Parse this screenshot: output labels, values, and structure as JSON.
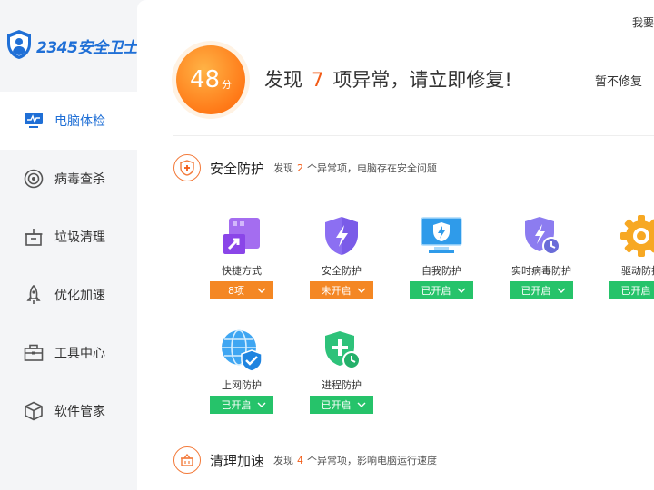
{
  "app": {
    "logo_text": "2345安全卫士"
  },
  "sidebar": {
    "items": [
      {
        "label": "电脑体检",
        "icon": "monitor-icon",
        "active": true
      },
      {
        "label": "病毒查杀",
        "icon": "target-icon"
      },
      {
        "label": "垃圾清理",
        "icon": "cleaner-icon"
      },
      {
        "label": "优化加速",
        "icon": "rocket-icon"
      },
      {
        "label": "工具中心",
        "icon": "toolbox-icon"
      },
      {
        "label": "软件管家",
        "icon": "box-icon"
      }
    ]
  },
  "topbar": {
    "text": "我要"
  },
  "summary": {
    "score": "48",
    "score_unit": "分",
    "headline_prefix": "发现",
    "headline_count": "7",
    "headline_suffix": "项异常，请立即修复!",
    "repair_later": "暂不修复"
  },
  "sections": [
    {
      "title": "安全防护",
      "desc_prefix": "发现",
      "desc_count": "2",
      "desc_suffix": "个异常项，电脑存在安全问题",
      "icon": "shield-plus-icon",
      "items": [
        {
          "label": "快捷方式",
          "status": "8项",
          "status_type": "warning",
          "icon": "shortcut-icon"
        },
        {
          "label": "安全防护",
          "status": "未开启",
          "status_type": "warning",
          "icon": "shield-bolt-icon"
        },
        {
          "label": "自我防护",
          "status": "已开启",
          "status_type": "ok",
          "icon": "monitor-shield-icon"
        },
        {
          "label": "实时病毒防护",
          "status": "已开启",
          "status_type": "ok",
          "icon": "shield-clock-icon"
        },
        {
          "label": "驱动防护",
          "status": "已开启",
          "status_type": "ok",
          "icon": "gear-icon"
        },
        {
          "label": "上网防护",
          "status": "已开启",
          "status_type": "ok",
          "icon": "globe-shield-icon"
        },
        {
          "label": "进程防护",
          "status": "已开启",
          "status_type": "ok",
          "icon": "shield-plus-clock-icon"
        }
      ]
    },
    {
      "title": "清理加速",
      "desc_prefix": "发现",
      "desc_count": "4",
      "desc_suffix": "个异常项，影响电脑运行速度",
      "icon": "basket-icon"
    }
  ],
  "colors": {
    "accent": "#1f6fd6",
    "warning": "#f48724",
    "ok": "#26c36a",
    "alert_text": "#f25b16"
  }
}
